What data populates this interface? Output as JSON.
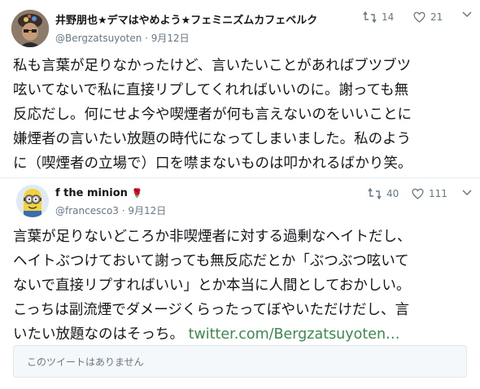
{
  "tweet1": {
    "display_name": "井野朋也★デマはやめよう★フェミニズムカフェベルク",
    "handle": "@Bergzatsuyoten",
    "date": "9月12日",
    "retweets": "14",
    "likes": "21",
    "lines": [
      "私も言葉が足りなかったけど、言いたいことがあればブツブツ",
      "呟いてないで私に直接リプしてくれればいいのに。謝っても無",
      "反応だし。何にせよ今や喫煙者が何も言えないのをいいことに",
      "嫌煙者の言いたい放題の時代になってしまいました。私のよう",
      "に（喫煙者の立場で）口を噤まないものは叩かれるばかり笑。"
    ]
  },
  "tweet2": {
    "display_name": "f the minion",
    "name_emoji": "🌹",
    "handle": "@francesco3",
    "date": "9月12日",
    "retweets": "40",
    "likes": "111",
    "lines": [
      "言葉が足りないどころか非喫煙者に対する過剰なヘイトだし、",
      "ヘイトぶつけておいて謝っても無反応だとか「ぶつぶつ呟いて",
      "ないで直接リプすればいい」とか本当に人間としておかしい。",
      "こっちは副流煙でダメージくらったってぼやいただけだし、言"
    ],
    "last_line_text": "いたい放題なのはそっち。",
    "link_text": "twitter.com/Bergzatsuyoten…"
  },
  "unavailable_text": "このツイートはありません",
  "colors": {
    "link": "#3b8a4e",
    "secondary_text": "#657786",
    "rose": "#c0162c"
  }
}
